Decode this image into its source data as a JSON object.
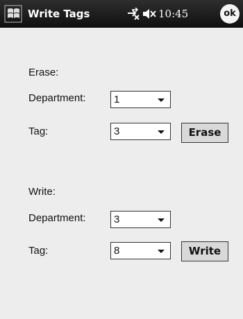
{
  "titlebar": {
    "title": "Write Tags",
    "clock": "10:45",
    "ok_label": "ok"
  },
  "erase": {
    "section_label": "Erase:",
    "department_label": "Department:",
    "department_value": "1",
    "tag_label": "Tag:",
    "tag_value": "3",
    "button_label": "Erase"
  },
  "write": {
    "section_label": "Write:",
    "department_label": "Department:",
    "department_value": "3",
    "tag_label": "Tag:",
    "tag_value": "8",
    "button_label": "Write"
  }
}
